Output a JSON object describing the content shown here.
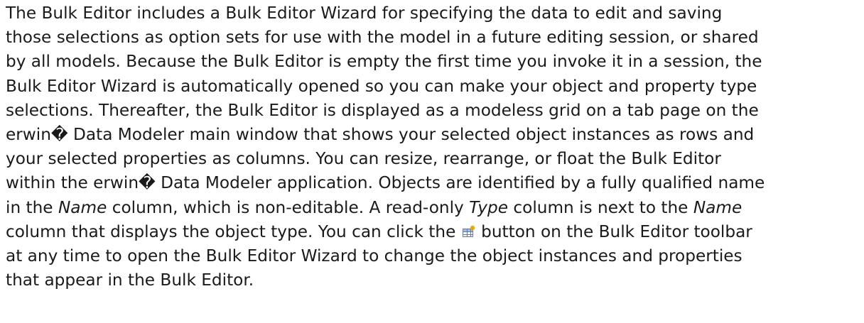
{
  "paragraph": {
    "l1": "The Bulk Editor includes a Bulk Editor Wizard for specifying the data to edit and saving",
    "l2": "those selections as option sets for use with the model in a future editing session, or shared",
    "l3": "by all models. Because the Bulk Editor is empty the first time you invoke it in a session, the",
    "l4": "Bulk Editor Wizard is automatically opened so you can make your object and property type",
    "l5": "selections. Thereafter, the Bulk Editor is displayed as a modeless grid on a tab page on the",
    "l6": "erwin� Data Modeler main window that shows your selected object instances as rows and",
    "l7": "your selected properties as columns. You can resize, rearrange, or float the Bulk Editor",
    "l8": "within the erwin� Data Modeler application. Objects are identified by a fully qualified name",
    "l9_a": "in the ",
    "l9_name": "Name",
    "l9_b": " column, which is non-editable. A read-only ",
    "l9_type": "Type",
    "l9_c": " column is next to the ",
    "l9_name2": "Name",
    "l10_a": "column that displays the object type. You can click the ",
    "l10_b": " button on the Bulk Editor toolbar",
    "l11": "at any time to open the Bulk Editor Wizard to change the object instances and properties",
    "l12": "that appear in the Bulk Editor."
  },
  "icons": {
    "toolbar_button": "bulk-editor-wizard-icon"
  }
}
